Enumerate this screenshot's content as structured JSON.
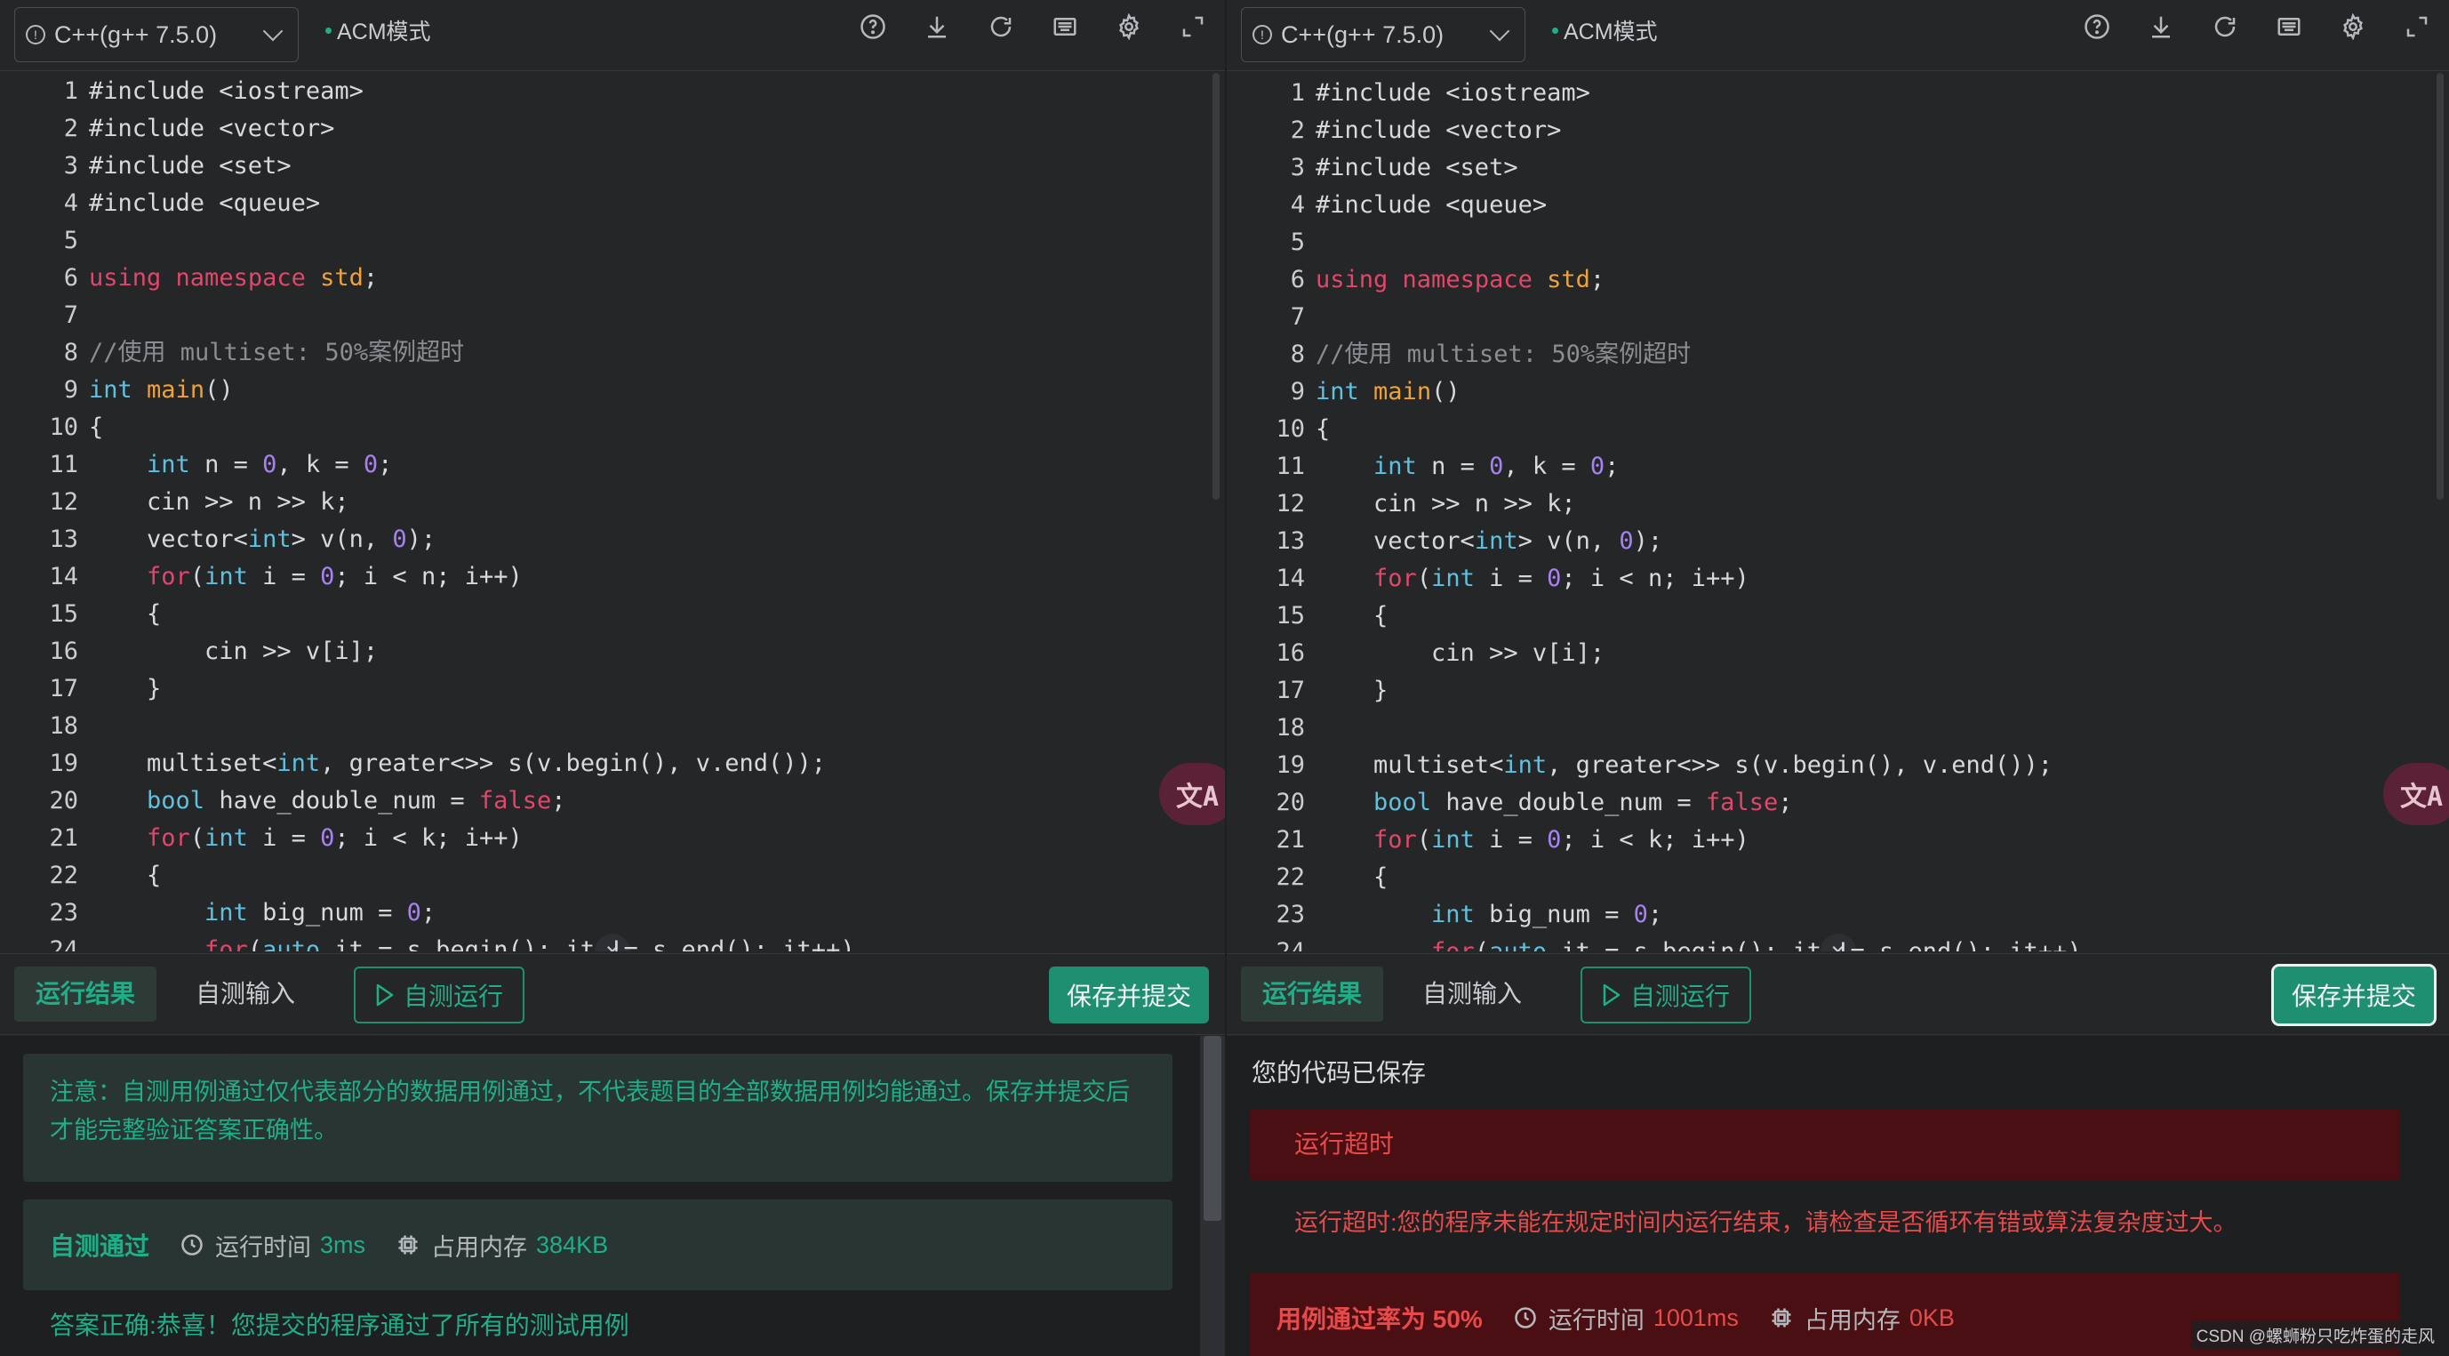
{
  "colors": {
    "accent": "#1fae88",
    "error": "#e64a4a",
    "keyword": "#e2466b",
    "type": "#5ec1e0",
    "number": "#a781f0",
    "function": "#f0a23a",
    "comment": "#8a8d92"
  },
  "left": {
    "toolbar": {
      "language": "C++(g++ 7.5.0)",
      "mode": "ACM模式",
      "icons": [
        "help-icon",
        "download-icon",
        "reset-icon",
        "keyboard-icon",
        "gear-icon",
        "fullscreen-icon"
      ]
    },
    "tabs": {
      "result": "运行结果",
      "input": "自测输入",
      "run": "自测运行",
      "submit": "保存并提交"
    },
    "result": {
      "note": "注意：自测用例通过仅代表部分的数据用例通过，不代表题目的全部数据用例均能通过。保存并提交后才能完整验证答案正确性。",
      "status": "自测通过",
      "time_label": "运行时间",
      "time_value": "3ms",
      "mem_label": "占用内存",
      "mem_value": "384KB",
      "answer": "答案正确:恭喜！您提交的程序通过了所有的测试用例"
    }
  },
  "right": {
    "toolbar": {
      "language": "C++(g++ 7.5.0)",
      "mode": "ACM模式",
      "icons": [
        "help-icon",
        "download-icon",
        "reset-icon",
        "keyboard-icon",
        "gear-icon",
        "fullscreen-icon"
      ]
    },
    "tabs": {
      "result": "运行结果",
      "input": "自测输入",
      "run": "自测运行",
      "submit": "保存并提交"
    },
    "result": {
      "saved": "您的代码已保存",
      "tle_title": "运行超时",
      "tle_desc": "运行超时:您的程序未能在规定时间内运行结束，请检查是否循环有错或算法复杂度过大。",
      "status": "用例通过率为 50%",
      "time_label": "运行时间",
      "time_value": "1001ms",
      "mem_label": "占用内存",
      "mem_value": "0KB"
    }
  },
  "code_lines": [
    [
      [
        "pp",
        "#include <iostream>"
      ]
    ],
    [
      [
        "pp",
        "#include <vector>"
      ]
    ],
    [
      [
        "pp",
        "#include <set>"
      ]
    ],
    [
      [
        "pp",
        "#include <queue>"
      ]
    ],
    [],
    [
      [
        "kw",
        "using"
      ],
      [
        "pl",
        " "
      ],
      [
        "kw",
        "namespace"
      ],
      [
        "pl",
        " "
      ],
      [
        "std",
        "std"
      ],
      [
        "pl",
        ";"
      ]
    ],
    [],
    [
      [
        "cm",
        "//使用 multiset: 50%案例超时"
      ]
    ],
    [
      [
        "ty",
        "int"
      ],
      [
        "pl",
        " "
      ],
      [
        "fn",
        "main"
      ],
      [
        "pl",
        "()"
      ]
    ],
    [
      [
        "pl",
        "{"
      ]
    ],
    [
      [
        "pl",
        "    "
      ],
      [
        "ty",
        "int"
      ],
      [
        "pl",
        " n = "
      ],
      [
        "num",
        "0"
      ],
      [
        "pl",
        ", k = "
      ],
      [
        "num",
        "0"
      ],
      [
        "pl",
        ";"
      ]
    ],
    [
      [
        "pl",
        "    cin >> n >> k;"
      ]
    ],
    [
      [
        "pl",
        "    vector<"
      ],
      [
        "ty",
        "int"
      ],
      [
        "pl",
        "> v(n, "
      ],
      [
        "num",
        "0"
      ],
      [
        "pl",
        ");"
      ]
    ],
    [
      [
        "pl",
        "    "
      ],
      [
        "kw",
        "for"
      ],
      [
        "pl",
        "("
      ],
      [
        "ty",
        "int"
      ],
      [
        "pl",
        " i = "
      ],
      [
        "num",
        "0"
      ],
      [
        "pl",
        "; i < n; i++)"
      ]
    ],
    [
      [
        "pl",
        "    {"
      ]
    ],
    [
      [
        "pl",
        "        cin >> v[i];"
      ]
    ],
    [
      [
        "pl",
        "    }"
      ]
    ],
    [],
    [
      [
        "pl",
        "    multiset<"
      ],
      [
        "ty",
        "int"
      ],
      [
        "pl",
        ", greater<>> s(v.begin(), v.end());"
      ]
    ],
    [
      [
        "pl",
        "    "
      ],
      [
        "ty",
        "bool"
      ],
      [
        "pl",
        " have_double_num = "
      ],
      [
        "kw",
        "false"
      ],
      [
        "pl",
        ";"
      ]
    ],
    [
      [
        "pl",
        "    "
      ],
      [
        "kw",
        "for"
      ],
      [
        "pl",
        "("
      ],
      [
        "ty",
        "int"
      ],
      [
        "pl",
        " i = "
      ],
      [
        "num",
        "0"
      ],
      [
        "pl",
        "; i < k; i++)"
      ]
    ],
    [
      [
        "pl",
        "    {"
      ]
    ],
    [
      [
        "pl",
        "        "
      ],
      [
        "ty",
        "int"
      ],
      [
        "pl",
        " big_num = "
      ],
      [
        "num",
        "0"
      ],
      [
        "pl",
        ";"
      ]
    ],
    [
      [
        "pl",
        "        "
      ],
      [
        "kw",
        "for"
      ],
      [
        "pl",
        "("
      ],
      [
        "ty",
        "auto"
      ],
      [
        "pl",
        " it = s.begin(); it != s.end(); it++)"
      ]
    ]
  ],
  "translate_label": "文A",
  "watermark": "CSDN @螺蛳粉只吃炸蛋的走风"
}
